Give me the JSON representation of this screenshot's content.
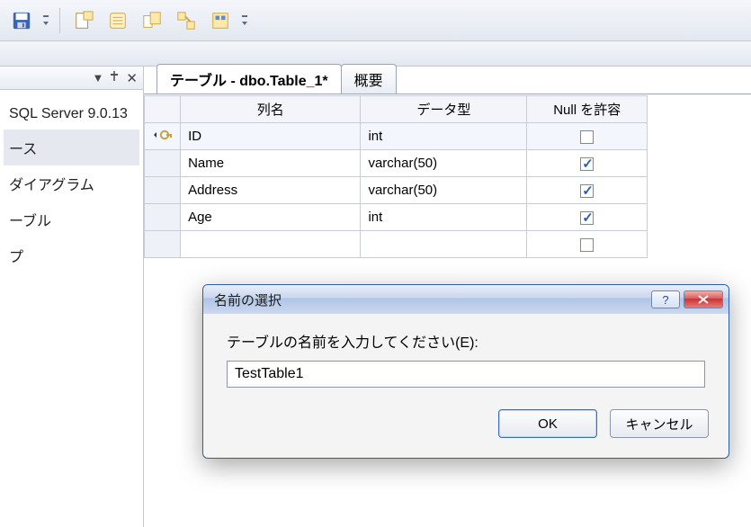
{
  "toolbar": {
    "icons": [
      "save-icon",
      "sep",
      "script-icon",
      "notes-icon",
      "tables-icon",
      "relations-icon",
      "properties-icon"
    ]
  },
  "left_panel": {
    "header_glyphs": [
      "▾",
      "⇱",
      "✕"
    ],
    "nodes": [
      {
        "label": "SQL Server 9.0.13",
        "selected": false
      },
      {
        "label": "ース",
        "selected": true
      },
      {
        "label": "ダイアグラム",
        "selected": false
      },
      {
        "label": "ーブル",
        "selected": false
      },
      {
        "label": "プ",
        "selected": false
      }
    ]
  },
  "tabs": [
    {
      "label": "テーブル - dbo.Table_1*",
      "active": true
    },
    {
      "label": "概要",
      "active": false
    }
  ],
  "designer": {
    "headers": {
      "name": "列名",
      "type": "データ型",
      "null": "Null を許容"
    },
    "rows": [
      {
        "key": true,
        "selected": true,
        "name": "ID",
        "type": "int",
        "allow_null": false
      },
      {
        "key": false,
        "selected": false,
        "name": "Name",
        "type": "varchar(50)",
        "allow_null": true
      },
      {
        "key": false,
        "selected": false,
        "name": "Address",
        "type": "varchar(50)",
        "allow_null": true
      },
      {
        "key": false,
        "selected": false,
        "name": "Age",
        "type": "int",
        "allow_null": true
      },
      {
        "key": false,
        "selected": false,
        "name": "",
        "type": "",
        "allow_null": false
      }
    ]
  },
  "dialog": {
    "title": "名前の選択",
    "prompt": "テーブルの名前を入力してください(E):",
    "value": "TestTable1",
    "ok": "OK",
    "cancel": "キャンセル"
  }
}
